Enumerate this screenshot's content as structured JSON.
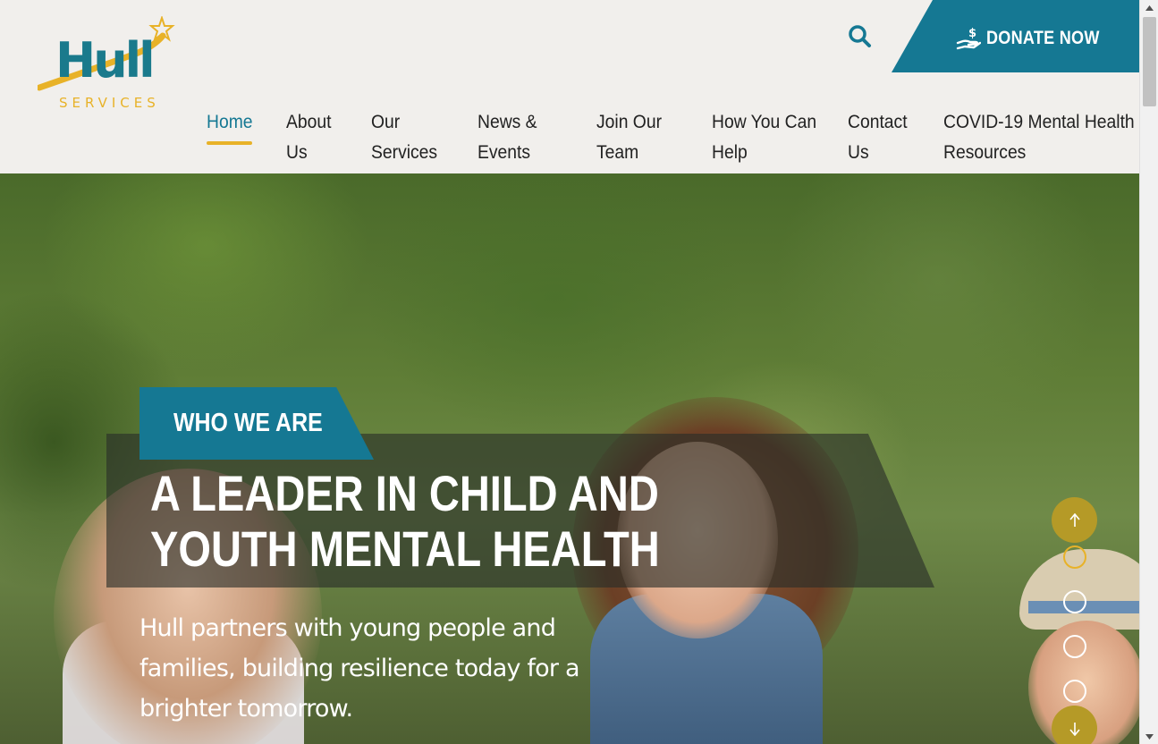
{
  "brand": {
    "logo_word": "Hull",
    "logo_sub": "SERVICES",
    "primary_color": "#157893",
    "accent_color": "#e8b228"
  },
  "header": {
    "search_icon": "search-icon",
    "donate_label": "DONATE NOW",
    "donate_icon": "donation-hand-icon"
  },
  "nav": {
    "items": [
      {
        "line1": "Home",
        "line2": ""
      },
      {
        "line1": "About",
        "line2": "Us"
      },
      {
        "line1": "Our",
        "line2": "Services"
      },
      {
        "line1": "News &",
        "line2": "Events"
      },
      {
        "line1": "Join Our",
        "line2": "Team"
      },
      {
        "line1": "How You Can",
        "line2": "Help"
      },
      {
        "line1": "Contact",
        "line2": "Us"
      },
      {
        "line1": "COVID-19 Mental Health",
        "line2": "Resources"
      }
    ],
    "active": "Home"
  },
  "hero": {
    "tag": "WHO WE ARE",
    "title_line1": "A LEADER IN CHILD AND",
    "title_line2": "YOUTH MENTAL HEALTH",
    "subtitle": "Hull partners with young people and families, building resilience today for a brighter tomorrow."
  },
  "slider": {
    "up_icon": "arrow-up-icon",
    "down_icon": "arrow-down-icon",
    "total_dots": 4,
    "active_index": 0
  }
}
